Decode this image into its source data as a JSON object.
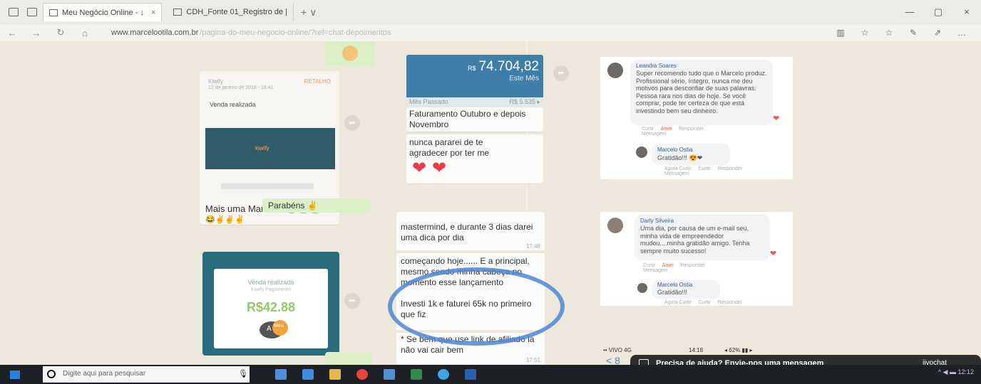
{
  "browser": {
    "tabs": [
      {
        "label": "Meu Negócio Online - ↓",
        "close": "×",
        "active": true
      },
      {
        "label": "CDH_Fonte 01_Registro de |",
        "close": "",
        "active": false
      }
    ],
    "new_tab": "+  ∨",
    "window_controls": [
      "—",
      "▢",
      "×"
    ],
    "url": "www.marcelootila.com.br",
    "url_rest": "/pagina-do-meu-negocio-online/?ref=chat-depoimentos",
    "toolbar_icons": [
      "▥",
      "☆",
      "☆",
      "✎",
      "⇗",
      "…"
    ],
    "nav": {
      "back": "←",
      "forward": "→",
      "refresh": "↻",
      "home": "⌂"
    }
  },
  "kiwify_card": {
    "header": "Kiwify",
    "tag": "RETALHO",
    "date": "12 de janeiro de 2018 - 18:41",
    "title": "Venda realizada",
    "logo": "kiwify",
    "caption": "Mais uma Marcelo! 😀😀😂",
    "emoji_row": "😂✌✌✌"
  },
  "parabens": "Parabéns ✌",
  "venda_card": {
    "title": "Venda realizada",
    "subtitle": "Kiwify Pagamento",
    "value": "R$42.88",
    "avatar": "A",
    "badge": "Meu"
  },
  "faturamento": {
    "currency": "R$",
    "amount": "74.704,82",
    "label": "Este Mês",
    "prev_label": "Mês Passado",
    "prev_value": "R$ 5.535 ▸",
    "message": "Faturamento Outubro e depois Novembro",
    "thanks": "nunca pararei de te agradecer por ter me mostrado esse mundo",
    "hearts": [
      "❤",
      "❤"
    ]
  },
  "chat_right": {
    "msg1": "mastermind, e durante 3 dias darei uma dica por dia",
    "msg2": "começando hoje...... E a principal, mesmo sendo minha cabeça no momento esse lançamento",
    "msg3": "Investi 1k e faturei 65k no primeiro que fiz",
    "msg4": "* Se bem que use link de afiliado lá não vai cair bem",
    "time1": "17:48",
    "time2": "17:51"
  },
  "fb_comments": [
    {
      "name": "Leandra Soares",
      "text": "Super recomendo tudo que o Marcelo produz. Profissional sério, íntegro, nunca me deu motivos para desconfiar de suas palavras. Pessoa rara nos dias de hoje. Se você comprar, pode ter certeza de que está investindo bem seu dinheiro.",
      "actions": [
        "Curtir",
        "Amei",
        "Responder",
        "Mensagem"
      ],
      "reply_name": "Marcelo Ostia",
      "reply_text": "Gratidão!!! 😍❤",
      "reply_actions": [
        "Agora Curtir",
        "Curtir",
        "Responder",
        "Mensagem"
      ]
    },
    {
      "name": "Darly Silveira",
      "text": "Uma dia, por causa de um e-mail seu, minha vida de empreendedor mudou....minha gratidão amigo. Tenha sempre muito sucesso!",
      "actions": [
        "Curtir",
        "Amei",
        "Responder",
        "Mensagem"
      ],
      "reply_name": "Marcelo Ostia",
      "reply_text": "Gratidão!!!",
      "reply_actions": [
        "Agora Curtir",
        "Curtir",
        "Responder"
      ]
    }
  ],
  "phone_status": {
    "carrier": "•• VIVO 4G",
    "time": "14:18",
    "battery": "◂ 62% ▮▮ ▸"
  },
  "help": {
    "text": "Precisa de ajuda? Envie-nos uma mensagem",
    "brand": "jivochat"
  },
  "back": "< 8",
  "taskbar": {
    "search_placeholder": "Digite aqui para pesquisar",
    "mic": "🎙",
    "tray": "^  ◀  ▬  12:12",
    "apps": [
      {
        "name": "edge",
        "color": "#3a8ee6"
      },
      {
        "name": "explorer",
        "color": "#e9b84a"
      },
      {
        "name": "chrome",
        "color": "#e8453c"
      },
      {
        "name": "photos",
        "color": "#4f8fd8"
      },
      {
        "name": "excel",
        "color": "#2f8c4e"
      },
      {
        "name": "ie",
        "color": "#3fa5e8"
      },
      {
        "name": "word",
        "color": "#2b5fb0"
      }
    ]
  }
}
